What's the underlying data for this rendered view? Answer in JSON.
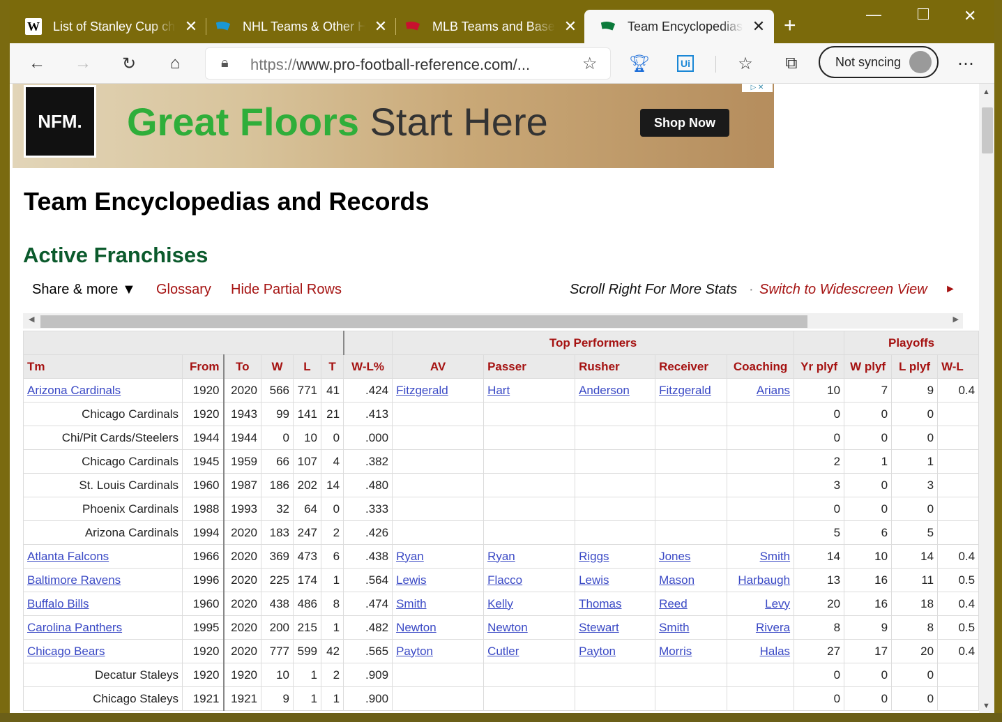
{
  "browser": {
    "tabs": [
      {
        "title": "List of Stanley Cup ch",
        "icon": "wikipedia-icon",
        "active": false
      },
      {
        "title": "NHL Teams & Other H",
        "icon": "hockey-ref-icon",
        "active": false
      },
      {
        "title": "MLB Teams and Baseb",
        "icon": "baseball-ref-icon",
        "active": false
      },
      {
        "title": "Team Encyclopedias a",
        "icon": "pfr-icon",
        "active": true
      }
    ],
    "new_tab": "+",
    "url_scheme": "https://",
    "url_rest": "www.pro-football-reference.com/...",
    "sync_label": "Not syncing"
  },
  "ad": {
    "logo": "NFM.",
    "headline_1": "Great Floors",
    "headline_2": "Start Here",
    "cta": "Shop Now"
  },
  "page": {
    "title": "Team Encyclopedias and Records",
    "section": "Active Franchises",
    "share": "Share & more ▼",
    "glossary": "Glossary",
    "hide_partial": "Hide Partial Rows",
    "scroll_hint": "Scroll Right For More Stats",
    "dot": "·",
    "widescreen": "Switch to Widescreen View",
    "arrow": "►"
  },
  "table": {
    "over_headers": {
      "top": "Top Performers",
      "playoffs": "Playoffs"
    },
    "columns": [
      "Tm",
      "From",
      "To",
      "W",
      "L",
      "T",
      "W-L%",
      "AV",
      "Passer",
      "Rusher",
      "Receiver",
      "Coaching",
      "Yr plyf",
      "W plyf",
      "L plyf",
      "W-L"
    ],
    "rows": [
      {
        "tm": "Arizona Cardinals",
        "link": true,
        "from": "1920",
        "to": "2020",
        "w": "566",
        "l": "771",
        "t": "41",
        "pct": ".424",
        "av": "Fitzgerald",
        "passer": "Hart",
        "rusher": "Anderson",
        "receiver": "Fitzgerald",
        "coach": "Arians",
        "yr": "10",
        "wp": "7",
        "lp": "9",
        "wl": "0.4"
      },
      {
        "tm": "Chicago Cardinals",
        "link": false,
        "from": "1920",
        "to": "1943",
        "w": "99",
        "l": "141",
        "t": "21",
        "pct": ".413",
        "av": "",
        "passer": "",
        "rusher": "",
        "receiver": "",
        "coach": "",
        "yr": "0",
        "wp": "0",
        "lp": "0",
        "wl": ""
      },
      {
        "tm": "Chi/Pit Cards/Steelers",
        "link": false,
        "from": "1944",
        "to": "1944",
        "w": "0",
        "l": "10",
        "t": "0",
        "pct": ".000",
        "av": "",
        "passer": "",
        "rusher": "",
        "receiver": "",
        "coach": "",
        "yr": "0",
        "wp": "0",
        "lp": "0",
        "wl": ""
      },
      {
        "tm": "Chicago Cardinals",
        "link": false,
        "from": "1945",
        "to": "1959",
        "w": "66",
        "l": "107",
        "t": "4",
        "pct": ".382",
        "av": "",
        "passer": "",
        "rusher": "",
        "receiver": "",
        "coach": "",
        "yr": "2",
        "wp": "1",
        "lp": "1",
        "wl": ""
      },
      {
        "tm": "St. Louis Cardinals",
        "link": false,
        "from": "1960",
        "to": "1987",
        "w": "186",
        "l": "202",
        "t": "14",
        "pct": ".480",
        "av": "",
        "passer": "",
        "rusher": "",
        "receiver": "",
        "coach": "",
        "yr": "3",
        "wp": "0",
        "lp": "3",
        "wl": ""
      },
      {
        "tm": "Phoenix Cardinals",
        "link": false,
        "from": "1988",
        "to": "1993",
        "w": "32",
        "l": "64",
        "t": "0",
        "pct": ".333",
        "av": "",
        "passer": "",
        "rusher": "",
        "receiver": "",
        "coach": "",
        "yr": "0",
        "wp": "0",
        "lp": "0",
        "wl": ""
      },
      {
        "tm": "Arizona Cardinals",
        "link": false,
        "from": "1994",
        "to": "2020",
        "w": "183",
        "l": "247",
        "t": "2",
        "pct": ".426",
        "av": "",
        "passer": "",
        "rusher": "",
        "receiver": "",
        "coach": "",
        "yr": "5",
        "wp": "6",
        "lp": "5",
        "wl": ""
      },
      {
        "tm": "Atlanta Falcons",
        "link": true,
        "from": "1966",
        "to": "2020",
        "w": "369",
        "l": "473",
        "t": "6",
        "pct": ".438",
        "av": "Ryan",
        "passer": "Ryan",
        "rusher": "Riggs",
        "receiver": "Jones",
        "coach": "Smith",
        "yr": "14",
        "wp": "10",
        "lp": "14",
        "wl": "0.4"
      },
      {
        "tm": "Baltimore Ravens",
        "link": true,
        "from": "1996",
        "to": "2020",
        "w": "225",
        "l": "174",
        "t": "1",
        "pct": ".564",
        "av": "Lewis",
        "passer": "Flacco",
        "rusher": "Lewis",
        "receiver": "Mason",
        "coach": "Harbaugh",
        "yr": "13",
        "wp": "16",
        "lp": "11",
        "wl": "0.5"
      },
      {
        "tm": "Buffalo Bills",
        "link": true,
        "from": "1960",
        "to": "2020",
        "w": "438",
        "l": "486",
        "t": "8",
        "pct": ".474",
        "av": "Smith",
        "passer": "Kelly",
        "rusher": "Thomas",
        "receiver": "Reed",
        "coach": "Levy",
        "yr": "20",
        "wp": "16",
        "lp": "18",
        "wl": "0.4"
      },
      {
        "tm": "Carolina Panthers",
        "link": true,
        "from": "1995",
        "to": "2020",
        "w": "200",
        "l": "215",
        "t": "1",
        "pct": ".482",
        "av": "Newton",
        "passer": "Newton",
        "rusher": "Stewart",
        "receiver": "Smith",
        "coach": "Rivera",
        "yr": "8",
        "wp": "9",
        "lp": "8",
        "wl": "0.5"
      },
      {
        "tm": "Chicago Bears",
        "link": true,
        "from": "1920",
        "to": "2020",
        "w": "777",
        "l": "599",
        "t": "42",
        "pct": ".565",
        "av": "Payton",
        "passer": "Cutler",
        "rusher": "Payton",
        "receiver": "Morris",
        "coach": "Halas",
        "yr": "27",
        "wp": "17",
        "lp": "20",
        "wl": "0.4"
      },
      {
        "tm": "Decatur Staleys",
        "link": false,
        "from": "1920",
        "to": "1920",
        "w": "10",
        "l": "1",
        "t": "2",
        "pct": ".909",
        "av": "",
        "passer": "",
        "rusher": "",
        "receiver": "",
        "coach": "",
        "yr": "0",
        "wp": "0",
        "lp": "0",
        "wl": ""
      },
      {
        "tm": "Chicago Staleys",
        "link": false,
        "from": "1921",
        "to": "1921",
        "w": "9",
        "l": "1",
        "t": "1",
        "pct": ".900",
        "av": "",
        "passer": "",
        "rusher": "",
        "receiver": "",
        "coach": "",
        "yr": "0",
        "wp": "0",
        "lp": "0",
        "wl": ""
      }
    ]
  },
  "colors": {
    "title_bar": "#7b6a0b",
    "section_green": "#0b5a2c",
    "link_red": "#a51211",
    "link_blue": "#3a49c5"
  }
}
